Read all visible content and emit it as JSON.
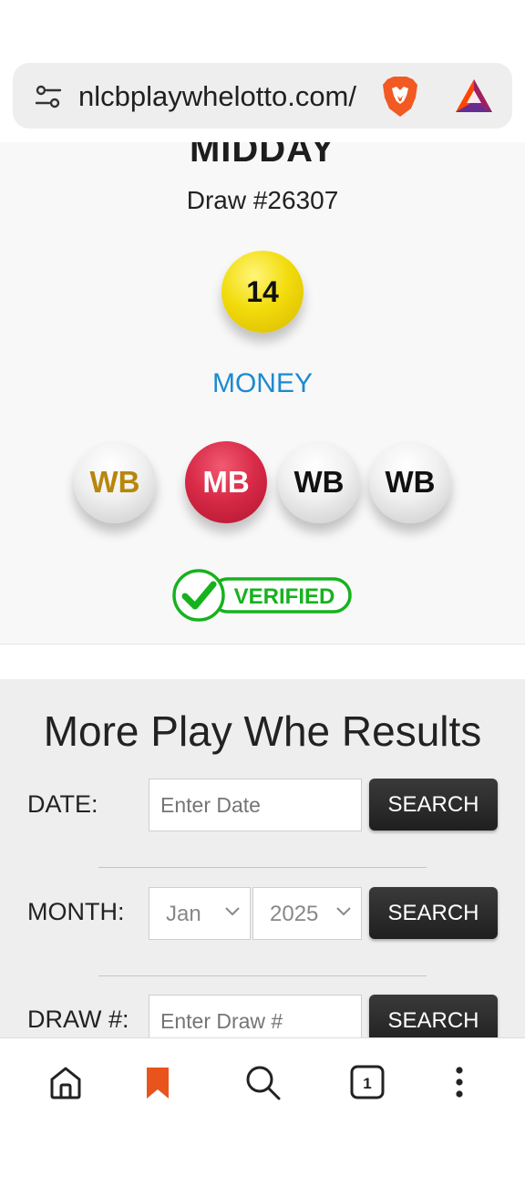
{
  "browser": {
    "url": "nlcbplaywhelotto.com/",
    "icons": [
      "tune-icon",
      "brave-lion-icon",
      "bat-rewards-icon"
    ]
  },
  "result": {
    "draw_title": "MIDDAY",
    "draw_number": "Draw #26307",
    "main_number": "14",
    "main_ball_color": "#f2dc0c",
    "mark_name": "MONEY",
    "mark_color": "#1b8ad1",
    "bonus_balls": [
      {
        "label": "WB",
        "type": "white",
        "text_color": "#b8860b"
      },
      {
        "label": "MB",
        "type": "red",
        "text_color": "#ffffff"
      },
      {
        "label": "WB",
        "type": "white",
        "text_color": "#111111"
      },
      {
        "label": "WB",
        "type": "white",
        "text_color": "#111111"
      }
    ],
    "verified_label": "VERIFIED",
    "verified_color": "#16b21e"
  },
  "more_results": {
    "title": "More Play Whe Results",
    "date_label": "DATE:",
    "date_placeholder": "Enter Date",
    "month_label": "MONTH:",
    "month_value": "Jan",
    "year_value": "2025",
    "draw_label": "DRAW #:",
    "draw_placeholder": "Enter Draw #",
    "search_label": "SEARCH"
  },
  "bottom_nav": {
    "tab_count": "1",
    "bookmark_color": "#e8541c",
    "icons": [
      "home-icon",
      "bookmark-icon",
      "search-icon",
      "tabs-icon",
      "more-menu-icon"
    ]
  }
}
